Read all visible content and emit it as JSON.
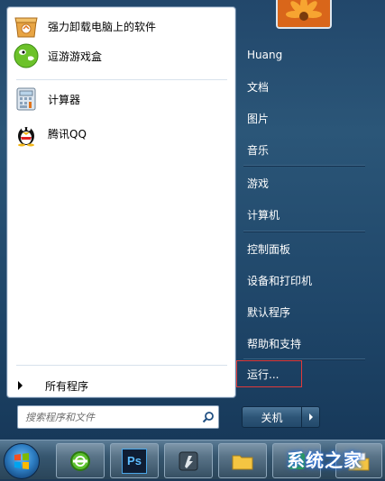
{
  "left_panel": {
    "apps": [
      {
        "label": "强力卸载电脑上的软件",
        "icon": "uninstall-box-icon"
      },
      {
        "label": "逗游游戏盒",
        "icon": "game-box-icon"
      },
      {
        "label": "计算器",
        "icon": "calculator-icon"
      },
      {
        "label": "腾讯QQ",
        "icon": "qq-penguin-icon"
      }
    ],
    "all_programs": "所有程序",
    "search_placeholder": "搜索程序和文件"
  },
  "right_panel": {
    "items": [
      "Huang",
      "文档",
      "图片",
      "音乐",
      "游戏",
      "计算机",
      "控制面板",
      "设备和打印机",
      "默认程序",
      "帮助和支持",
      "运行..."
    ],
    "shutdown_label": "关机"
  },
  "taskbar": {
    "buttons": [
      "ie-icon",
      "photoshop-icon",
      "flash-icon",
      "folder-icon",
      "green-app-icon"
    ],
    "ps_label": "Ps",
    "watermark_text": "系统之家"
  },
  "colors": {
    "accent": "#2b5678",
    "highlight": "#e03a3a"
  }
}
